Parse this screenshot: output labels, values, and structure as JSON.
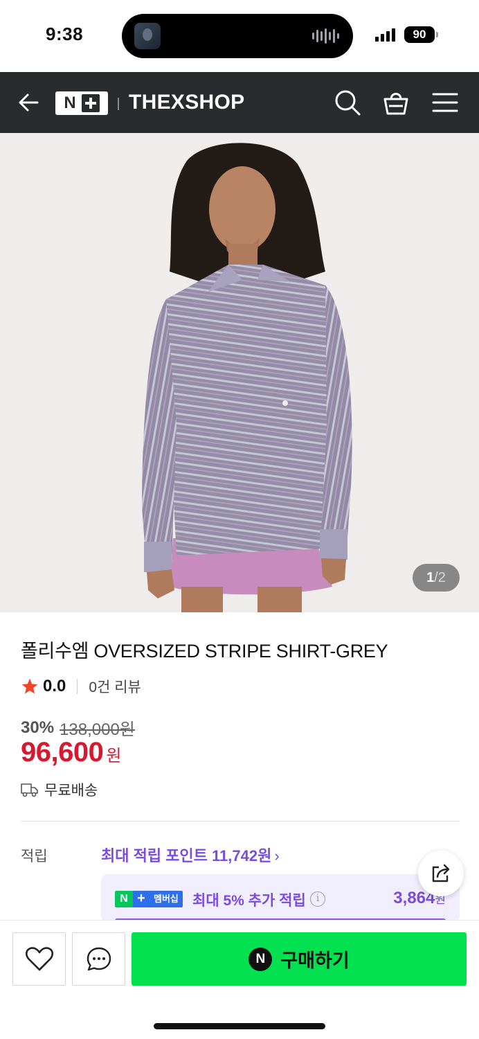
{
  "status_bar": {
    "time": "9:38",
    "battery": "90"
  },
  "header": {
    "shop_name": "THEXSHOP",
    "logo_text": "N"
  },
  "image": {
    "current": "1",
    "separator": "/",
    "total": "2"
  },
  "product": {
    "title": "폴리수엠 OVERSIZED STRIPE SHIRT-GREY",
    "rating": "0.0",
    "reviews": "0건 리뷰",
    "discount": "30%",
    "original_price": "138,000원",
    "sale_price": "96,600",
    "price_unit": "원",
    "shipping": "무료배송"
  },
  "points": {
    "label": "적립",
    "max_points": "최대 적립 포인트 11,742원",
    "chevron": "›",
    "member_badge": "멤버십",
    "member_desc": "최대 5% 추가 적립",
    "member_amount": "3,864",
    "member_unit": "원"
  },
  "bottom": {
    "buy_label": "구매하기",
    "buy_logo": "N"
  },
  "colors": {
    "header_bg": "#2a2b2e",
    "price_red": "#d7192f",
    "accent_purple": "#7a4be0",
    "buy_green": "#03e050"
  },
  "icons": [
    "back-arrow-icon",
    "search-icon",
    "cart-icon",
    "menu-icon",
    "star-icon",
    "truck-icon",
    "info-icon",
    "share-icon",
    "heart-icon",
    "chat-icon"
  ]
}
